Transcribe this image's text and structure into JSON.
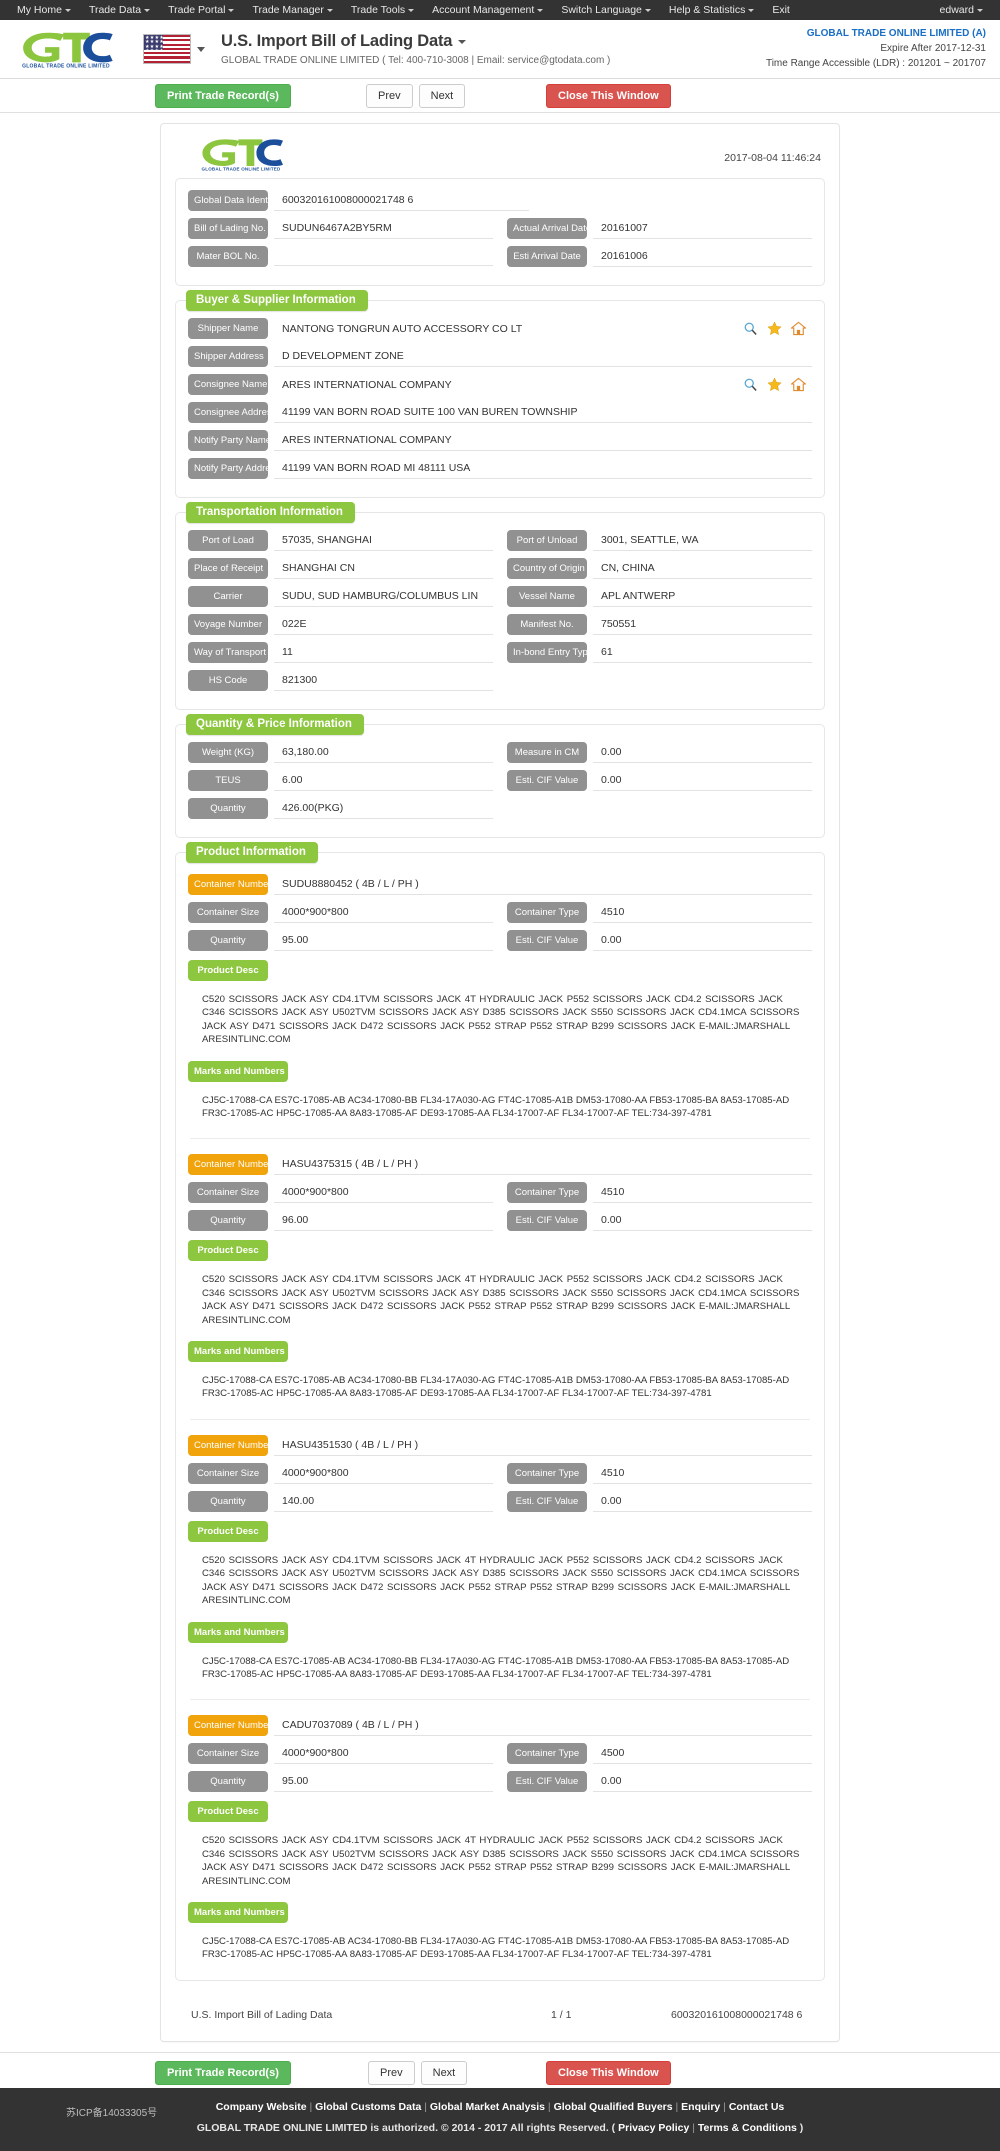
{
  "topnav": {
    "items": [
      {
        "label": "My Home",
        "caret": true
      },
      {
        "label": "Trade Data",
        "caret": true
      },
      {
        "label": "Trade Portal",
        "caret": true
      },
      {
        "label": "Trade Manager",
        "caret": true
      },
      {
        "label": "Trade Tools",
        "caret": true
      },
      {
        "label": "Account Management",
        "caret": true
      },
      {
        "label": "Switch Language",
        "caret": true
      },
      {
        "label": "Help & Statistics",
        "caret": true
      },
      {
        "label": "Exit",
        "caret": false
      }
    ],
    "user": "edward"
  },
  "header": {
    "title": "U.S. Import Bill of Lading Data",
    "company_line": "GLOBAL TRADE ONLINE LIMITED ( Tel: 400-710-3008  |  Email: service@gtodata.com )",
    "account": "GLOBAL TRADE ONLINE LIMITED (A)",
    "expire": "Expire After 2017-12-31",
    "time_range": "Time Range Accessible (LDR) : 201201 ~ 201707",
    "logo_text": "GLOBAL TRADE ONLINE LIMITED",
    "flag_alt": "US"
  },
  "toolbar": {
    "print_label": "Print Trade Record(s)",
    "prev_label": "Prev",
    "next_label": "Next",
    "close_label": "Close This Window"
  },
  "document": {
    "timestamp": "2017-08-04 11:46:24",
    "identity": {
      "label_global_data_identity": "Global Data Identity",
      "value_global_data_identity": "600320161008000021748 6",
      "label_bill_of_lading_no": "Bill of Lading No.",
      "value_bill_of_lading_no": "SUDUN6467A2BY5RM",
      "label_actual_arrival_date": "Actual Arrival Date",
      "value_actual_arrival_date": "20161007",
      "label_master_bol_no": "Mater BOL No.",
      "value_master_bol_no": "",
      "label_esti_arrival_date": "Esti Arrival Date",
      "value_esti_arrival_date": "20161006"
    },
    "buyer_supplier": {
      "legend": "Buyer & Supplier Information",
      "fields": [
        {
          "label": "Shipper Name",
          "value": "NANTONG TONGRUN AUTO ACCESSORY CO LT",
          "icons": true
        },
        {
          "label": "Shipper Address",
          "value": "D DEVELOPMENT ZONE",
          "icons": false
        },
        {
          "label": "Consignee Name",
          "value": "ARES INTERNATIONAL COMPANY",
          "icons": true
        },
        {
          "label": "Consignee Address",
          "value": "41199 VAN BORN ROAD SUITE 100 VAN BUREN TOWNSHIP",
          "icons": false
        },
        {
          "label": "Notify Party Name",
          "value": "ARES INTERNATIONAL COMPANY",
          "icons": false
        },
        {
          "label": "Notify Party Address",
          "value": "41199 VAN BORN ROAD MI 48111 USA",
          "icons": false
        }
      ]
    },
    "transportation": {
      "legend": "Transportation Information",
      "rows": [
        {
          "l1": "Port of Load",
          "v1": "57035, SHANGHAI",
          "l2": "Port of Unload",
          "v2": "3001, SEATTLE, WA"
        },
        {
          "l1": "Place of Receipt",
          "v1": "SHANGHAI CN",
          "l2": "Country of Origin",
          "v2": "CN, CHINA"
        },
        {
          "l1": "Carrier",
          "v1": "SUDU, SUD HAMBURG/COLUMBUS LIN",
          "l2": "Vessel Name",
          "v2": "APL ANTWERP"
        },
        {
          "l1": "Voyage Number",
          "v1": "022E",
          "l2": "Manifest No.",
          "v2": "750551"
        },
        {
          "l1": "Way of Transport",
          "v1": "11",
          "l2": "In-bond Entry Type",
          "v2": "61"
        },
        {
          "l1": "HS Code",
          "v1": "821300",
          "l2": "",
          "v2": ""
        }
      ]
    },
    "quantity_price": {
      "legend": "Quantity & Price Information",
      "rows": [
        {
          "l1": "Weight (KG)",
          "v1": "63,180.00",
          "l2": "Measure in CM",
          "v2": "0.00"
        },
        {
          "l1": "TEUS",
          "v1": "6.00",
          "l2": "Esti. CIF Value",
          "v2": "0.00"
        },
        {
          "l1": "Quantity",
          "v1": "426.00(PKG)",
          "l2": "",
          "v2": ""
        }
      ]
    },
    "product_information": {
      "legend": "Product Information",
      "labels": {
        "container_number": "Container Number",
        "container_size": "Container Size",
        "container_type": "Container Type",
        "quantity": "Quantity",
        "esti_cif_value": "Esti. CIF Value",
        "product_desc": "Product Desc",
        "marks_and_numbers": "Marks and Numbers"
      },
      "containers": [
        {
          "number": "SUDU8880452 ( 4B / L / PH )",
          "size": "4000*900*800",
          "type": "4510",
          "quantity": "95.00",
          "cif": "0.00",
          "desc": "C520 SCISSORS JACK ASY CD4.1TVM SCISSORS JACK 4T HYDRAULIC JACK P552 SCISSORS JACK CD4.2 SCISSORS JACK C346 SCISSORS JACK ASY U502TVM SCISSORS JACK ASY D385 SCISSORS JACK S550 SCISSORS JACK CD4.1MCA SCISSORS JACK ASY D471 SCISSORS JACK D472 SCISSORS JACK P552 STRAP P552 STRAP B299 SCISSORS JACK E-MAIL:JMARSHALL ARESINTLINC.COM",
          "marks": "CJ5C-17088-CA ES7C-17085-AB AC34-17080-BB FL34-17A030-AG FT4C-17085-A1B DM53-17080-AA FB53-17085-BA 8A53-17085-AD FR3C-17085-AC HP5C-17085-AA 8A83-17085-AF DE93-17085-AA FL34-17007-AF FL34-17007-AF TEL:734-397-4781"
        },
        {
          "number": "HASU4375315 ( 4B / L / PH )",
          "size": "4000*900*800",
          "type": "4510",
          "quantity": "96.00",
          "cif": "0.00",
          "desc": "C520 SCISSORS JACK ASY CD4.1TVM SCISSORS JACK 4T HYDRAULIC JACK P552 SCISSORS JACK CD4.2 SCISSORS JACK C346 SCISSORS JACK ASY U502TVM SCISSORS JACK ASY D385 SCISSORS JACK S550 SCISSORS JACK CD4.1MCA SCISSORS JACK ASY D471 SCISSORS JACK D472 SCISSORS JACK P552 STRAP P552 STRAP B299 SCISSORS JACK E-MAIL:JMARSHALL ARESINTLINC.COM",
          "marks": "CJ5C-17088-CA ES7C-17085-AB AC34-17080-BB FL34-17A030-AG FT4C-17085-A1B DM53-17080-AA FB53-17085-BA 8A53-17085-AD FR3C-17085-AC HP5C-17085-AA 8A83-17085-AF DE93-17085-AA FL34-17007-AF FL34-17007-AF TEL:734-397-4781"
        },
        {
          "number": "HASU4351530 ( 4B / L / PH )",
          "size": "4000*900*800",
          "type": "4510",
          "quantity": "140.00",
          "cif": "0.00",
          "desc": "C520 SCISSORS JACK ASY CD4.1TVM SCISSORS JACK 4T HYDRAULIC JACK P552 SCISSORS JACK CD4.2 SCISSORS JACK C346 SCISSORS JACK ASY U502TVM SCISSORS JACK ASY D385 SCISSORS JACK S550 SCISSORS JACK CD4.1MCA SCISSORS JACK ASY D471 SCISSORS JACK D472 SCISSORS JACK P552 STRAP P552 STRAP B299 SCISSORS JACK E-MAIL:JMARSHALL ARESINTLINC.COM",
          "marks": "CJ5C-17088-CA ES7C-17085-AB AC34-17080-BB FL34-17A030-AG FT4C-17085-A1B DM53-17080-AA FB53-17085-BA 8A53-17085-AD FR3C-17085-AC HP5C-17085-AA 8A83-17085-AF DE93-17085-AA FL34-17007-AF FL34-17007-AF TEL:734-397-4781"
        },
        {
          "number": "CADU7037089 ( 4B / L / PH )",
          "size": "4000*900*800",
          "type": "4500",
          "quantity": "95.00",
          "cif": "0.00",
          "desc": "C520 SCISSORS JACK ASY CD4.1TVM SCISSORS JACK 4T HYDRAULIC JACK P552 SCISSORS JACK CD4.2 SCISSORS JACK C346 SCISSORS JACK ASY U502TVM SCISSORS JACK ASY D385 SCISSORS JACK S550 SCISSORS JACK CD4.1MCA SCISSORS JACK ASY D471 SCISSORS JACK D472 SCISSORS JACK P552 STRAP P552 STRAP B299 SCISSORS JACK E-MAIL:JMARSHALL ARESINTLINC.COM",
          "marks": "CJ5C-17088-CA ES7C-17085-AB AC34-17080-BB FL34-17A030-AG FT4C-17085-A1B DM53-17080-AA FB53-17085-BA 8A53-17085-AD FR3C-17085-AC HP5C-17085-AA 8A83-17085-AF DE93-17085-AA FL34-17007-AF FL34-17007-AF TEL:734-397-4781"
        }
      ]
    },
    "footer": {
      "doc_name": "U.S. Import Bill of Lading Data",
      "page": "1 / 1",
      "identity": "600320161008000021748 6"
    }
  },
  "site_footer": {
    "icp": "苏ICP备14033305号",
    "links": [
      "Company Website",
      "Global Customs Data",
      "Global Market Analysis",
      "Global Qualified Buyers",
      "Enquiry",
      "Contact Us"
    ],
    "copy_prefix": "GLOBAL TRADE ONLINE LIMITED is authorized. © 2014 - 2017 All rights Reserved.  (",
    "copy_links": [
      "Privacy Policy",
      "Terms & Conditions"
    ],
    "copy_suffix": ")"
  },
  "colors": {
    "nav_bg": "#333333",
    "green": "#8dc63f",
    "orange": "#f0a30a",
    "grey_label": "#919191",
    "btn_green": "#5cb85c",
    "btn_red": "#d9534f",
    "link_blue": "#1a6fc4"
  }
}
